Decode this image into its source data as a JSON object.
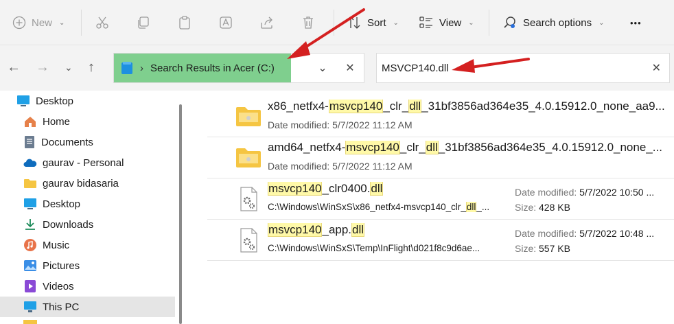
{
  "toolbar": {
    "new_label": "New",
    "sort_label": "Sort",
    "view_label": "View",
    "search_options_label": "Search options",
    "more_label": "•••"
  },
  "address": {
    "separator": "›",
    "location": "Search Results in Acer (C:)",
    "dropdown_glyph": "⌄",
    "close_glyph": "✕"
  },
  "search": {
    "query": "MSVCP140.dll",
    "clear_glyph": "✕"
  },
  "sidebar": {
    "items": [
      {
        "label": "Desktop",
        "icon": "desktop-icon"
      },
      {
        "label": "Home",
        "icon": "home-icon"
      },
      {
        "label": "Documents",
        "icon": "documents-icon"
      },
      {
        "label": "gaurav - Personal",
        "icon": "onedrive-icon"
      },
      {
        "label": "gaurav bidasaria",
        "icon": "folder-icon"
      },
      {
        "label": "Desktop",
        "icon": "desktop-icon"
      },
      {
        "label": "Downloads",
        "icon": "download-icon"
      },
      {
        "label": "Music",
        "icon": "music-icon"
      },
      {
        "label": "Pictures",
        "icon": "pictures-icon"
      },
      {
        "label": "Videos",
        "icon": "videos-icon"
      },
      {
        "label": "This PC",
        "icon": "pc-icon"
      }
    ]
  },
  "results": [
    {
      "name_parts": [
        "x86_netfx4-",
        "msvcp140",
        "_clr_",
        "dll",
        "_31bf3856ad364e35_4.0.15912.0_none_aa9..."
      ],
      "meta": "Date modified: 5/7/2022 11:12 AM"
    },
    {
      "name_parts": [
        "amd64_netfx4-",
        "msvcp140",
        "_clr_",
        "dll",
        "_31bf3856ad364e35_4.0.15912.0_none_..."
      ],
      "meta": "Date modified: 5/7/2022 11:12 AM"
    },
    {
      "name_parts": [
        "",
        "msvcp140",
        "_clr0400.",
        "dll",
        ""
      ],
      "path_parts": [
        "C:\\Windows\\WinSxS\\x86_netfx4-msvcp140_clr_",
        "dll",
        "_..."
      ],
      "date_label": "Date modified:",
      "date_value": "5/7/2022 10:50 ...",
      "size_label": "Size:",
      "size_value": "428 KB"
    },
    {
      "name_parts": [
        "",
        "msvcp140",
        "_app.",
        "dll",
        ""
      ],
      "path_parts": [
        "C:\\Windows\\WinSxS\\Temp\\InFlight\\d021f8c9d6ae...",
        "",
        ""
      ],
      "date_label": "Date modified:",
      "date_value": "5/7/2022 10:48 ...",
      "size_label": "Size:",
      "size_value": "557 KB"
    }
  ],
  "colors": {
    "highlight": "#fff9a8",
    "address_highlight": "#7fcf8e",
    "arrow": "#d42020",
    "folder": "#f5c542"
  }
}
